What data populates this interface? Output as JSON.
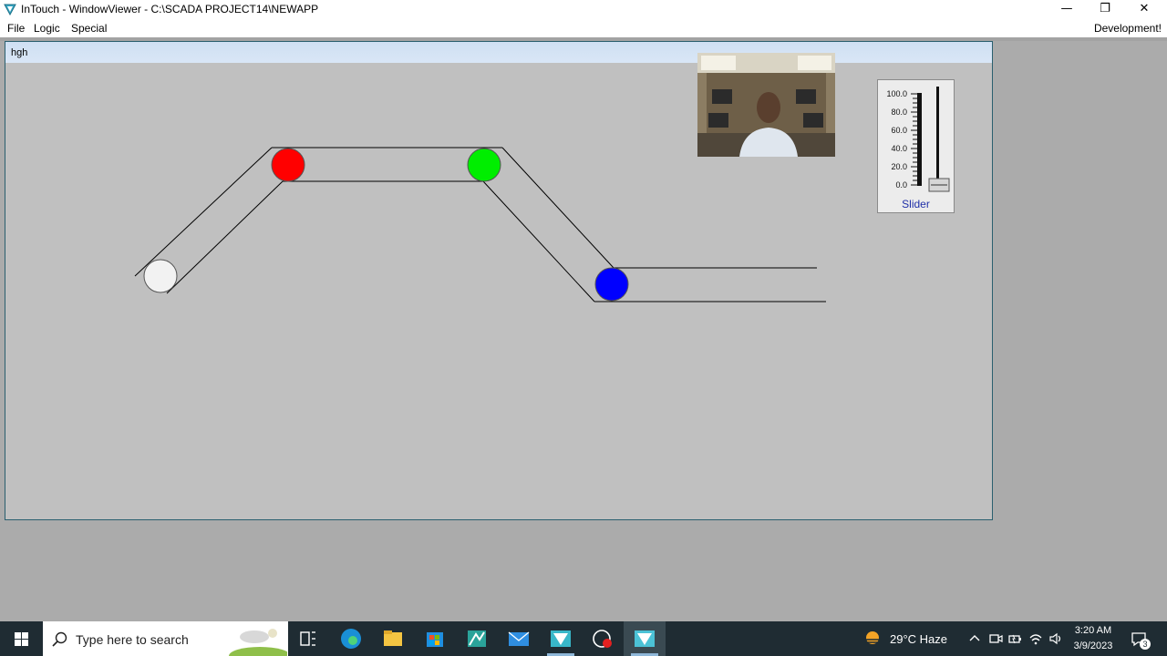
{
  "window": {
    "title": "InTouch - WindowViewer - C:\\SCADA PROJECT14\\NEWAPP"
  },
  "menu": {
    "items": [
      "File",
      "Logic",
      "Special"
    ],
    "right_label": "Development!"
  },
  "hmi": {
    "window_caption": "hgh",
    "balls": [
      {
        "name": "white",
        "color": "#f2f2f2"
      },
      {
        "name": "red",
        "color": "#ff0000"
      },
      {
        "name": "green",
        "color": "#00ee00"
      },
      {
        "name": "blue",
        "color": "#0000ff"
      }
    ],
    "slider": {
      "ticks": [
        "100.0",
        "80.0",
        "60.0",
        "40.0",
        "20.0",
        "0.0"
      ],
      "value": 0.0,
      "caption": "Slider"
    }
  },
  "taskbar": {
    "search_placeholder": "Type here to search",
    "apps": [
      "task-view-icon",
      "edge-icon",
      "file-explorer-icon",
      "store-icon",
      "intouch-manager-icon",
      "mail-icon",
      "intouch-app-icon",
      "recorder-icon",
      "windowviewer-icon"
    ],
    "weather": "29°C  Haze",
    "time": "3:20 AM",
    "date": "3/9/2023",
    "notifications": "3"
  },
  "colors": {
    "window_bg": "#c0c0c0",
    "taskbar_bg": "#1f2c33",
    "slider_caption": "#2030a8"
  }
}
